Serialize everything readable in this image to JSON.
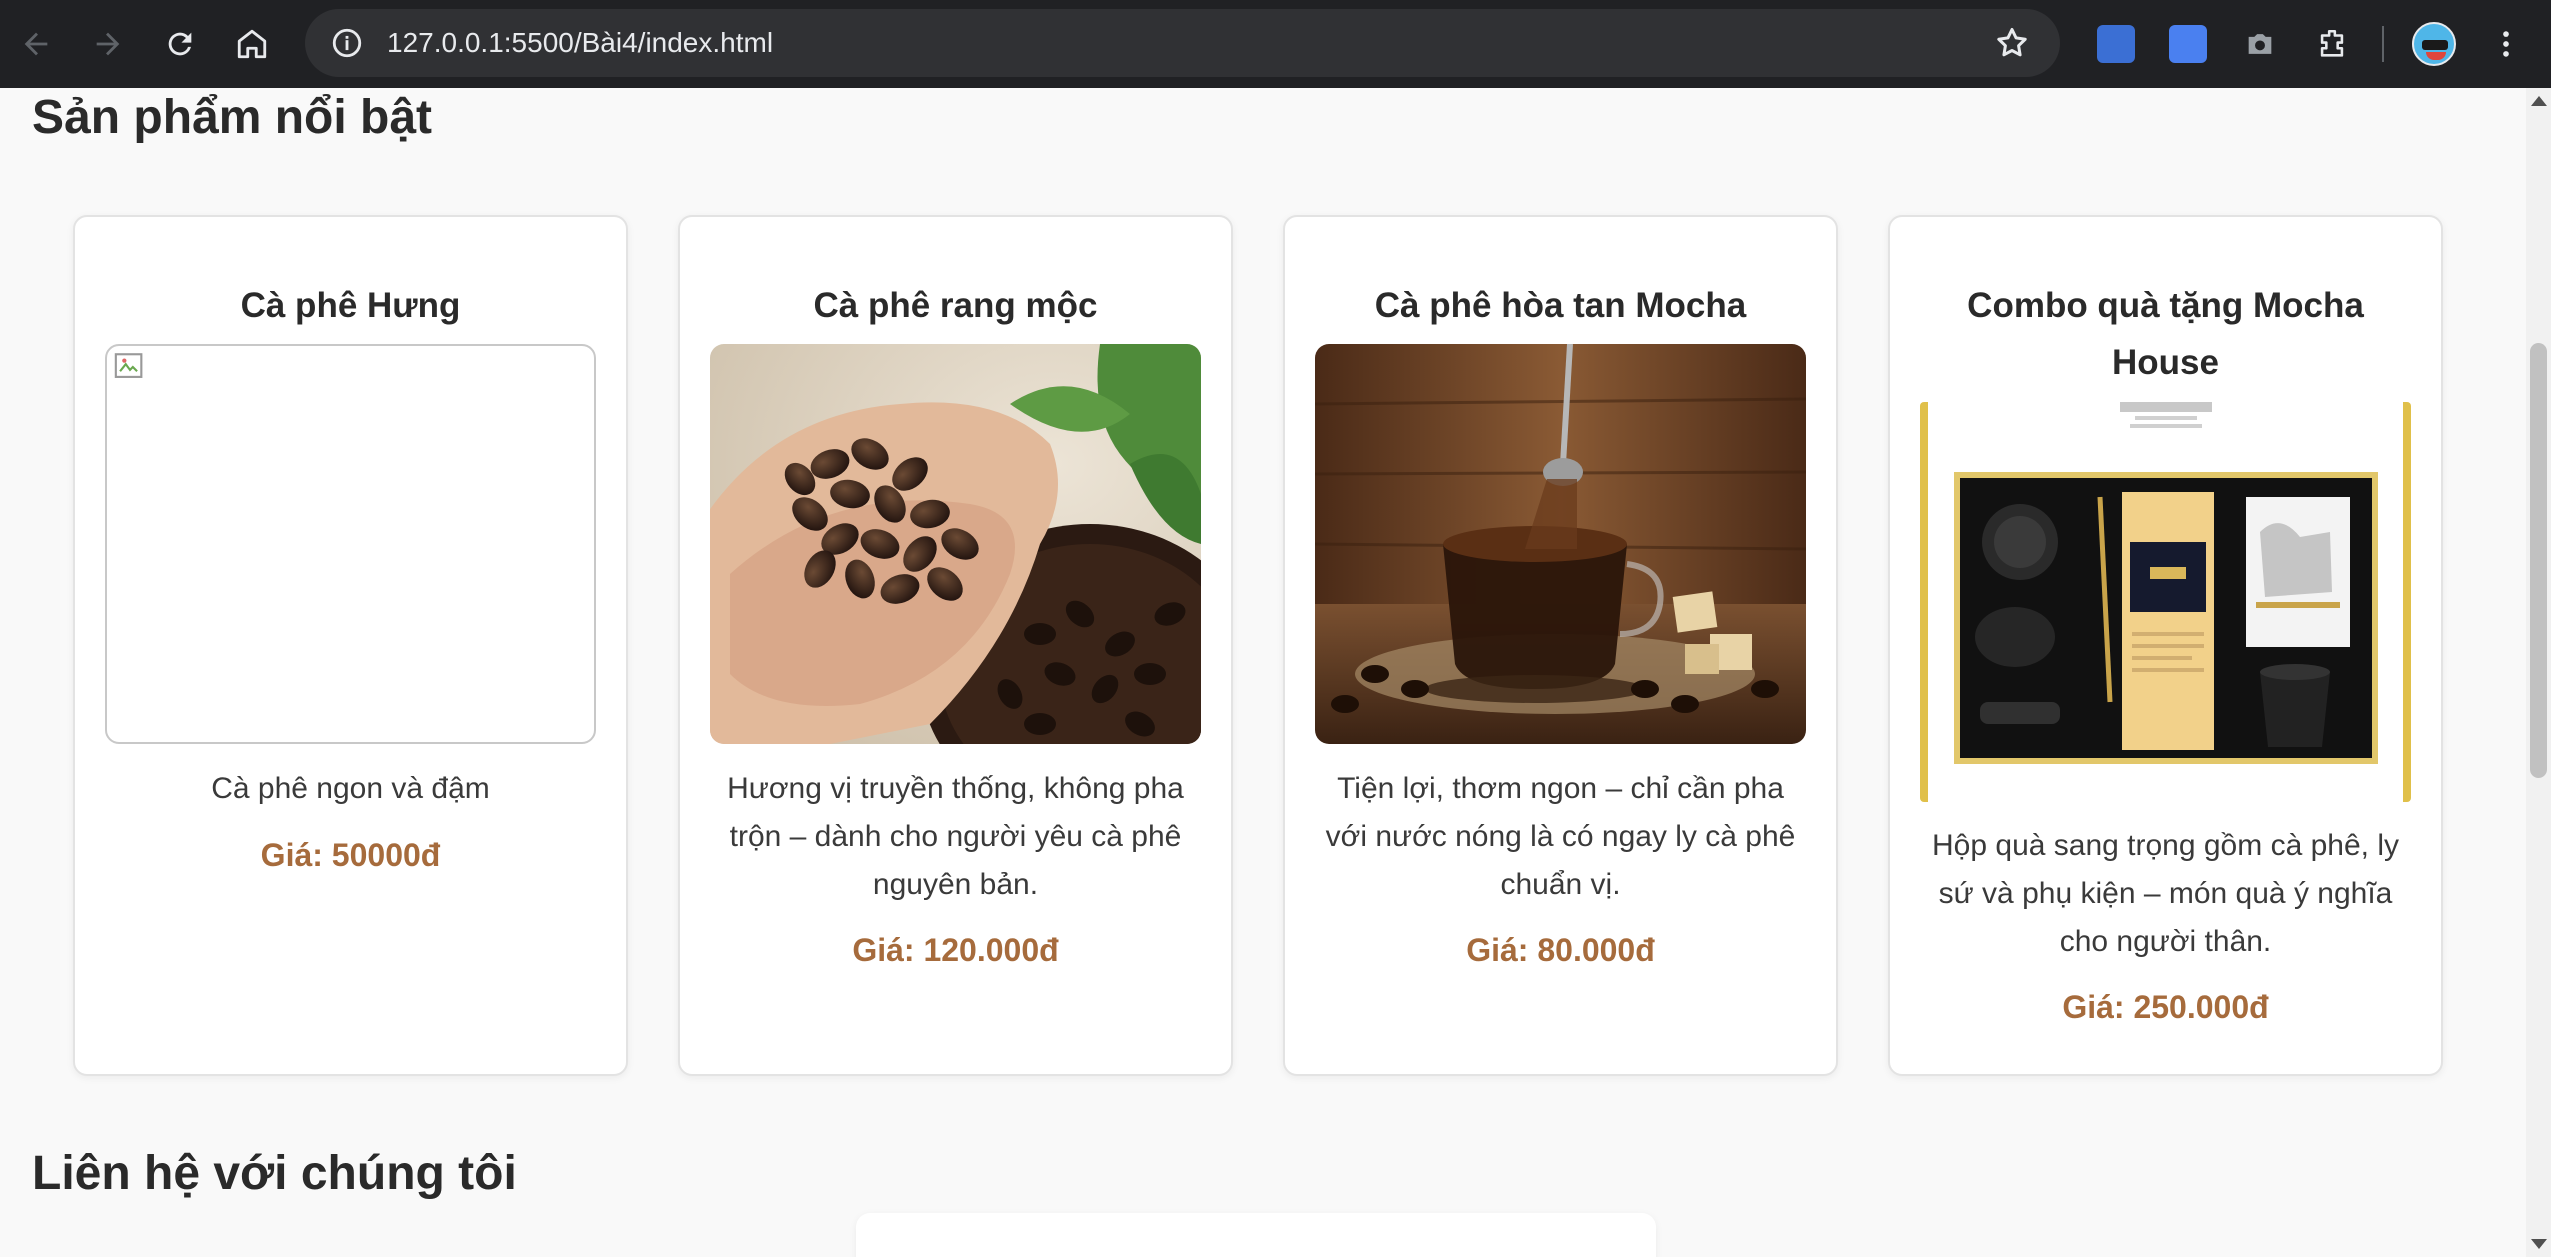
{
  "browser": {
    "url": "127.0.0.1:5500/Bài4/index.html",
    "icons": [
      "back-icon",
      "forward-icon",
      "reload-icon",
      "home-icon",
      "site-info-icon",
      "bookmark-star-icon",
      "extension-icon",
      "translate-icon",
      "camera-icon",
      "puzzle-icon",
      "profile-avatar",
      "menu-icon"
    ]
  },
  "page": {
    "featured_title": "Sản phẩm nổi bật",
    "contact_title": "Liên hệ với chúng tôi"
  },
  "products": [
    {
      "name": "Cà phê Hưng",
      "description": "Cà phê ngon và đậm",
      "price": "Giá: 50000đ",
      "image": "broken-image"
    },
    {
      "name": "Cà phê rang mộc",
      "description": "Hương vị truyền thống, không pha trộn – dành cho người yêu cà phê nguyên bản.",
      "price": "Giá: 120.000đ",
      "image": "coffee-beans-in-hand"
    },
    {
      "name": "Cà phê hòa tan Mocha",
      "description": "Tiện lợi, thơm ngon – chỉ cần pha với nước nóng là có ngay ly cà phê chuẩn vị.",
      "price": "Giá: 80.000đ",
      "image": "instant-coffee-cup"
    },
    {
      "name": "Combo quà tặng Mocha House",
      "description": "Hộp quà sang trọng gồm cà phê, ly sứ và phụ kiện – món quà ý nghĩa cho người thân.",
      "price": "Giá: 250.000đ",
      "image": "gift-box-set"
    }
  ],
  "colors": {
    "price": "#a66b3c",
    "chrome_bg": "#202124",
    "page_bg": "#f9f9f9"
  }
}
